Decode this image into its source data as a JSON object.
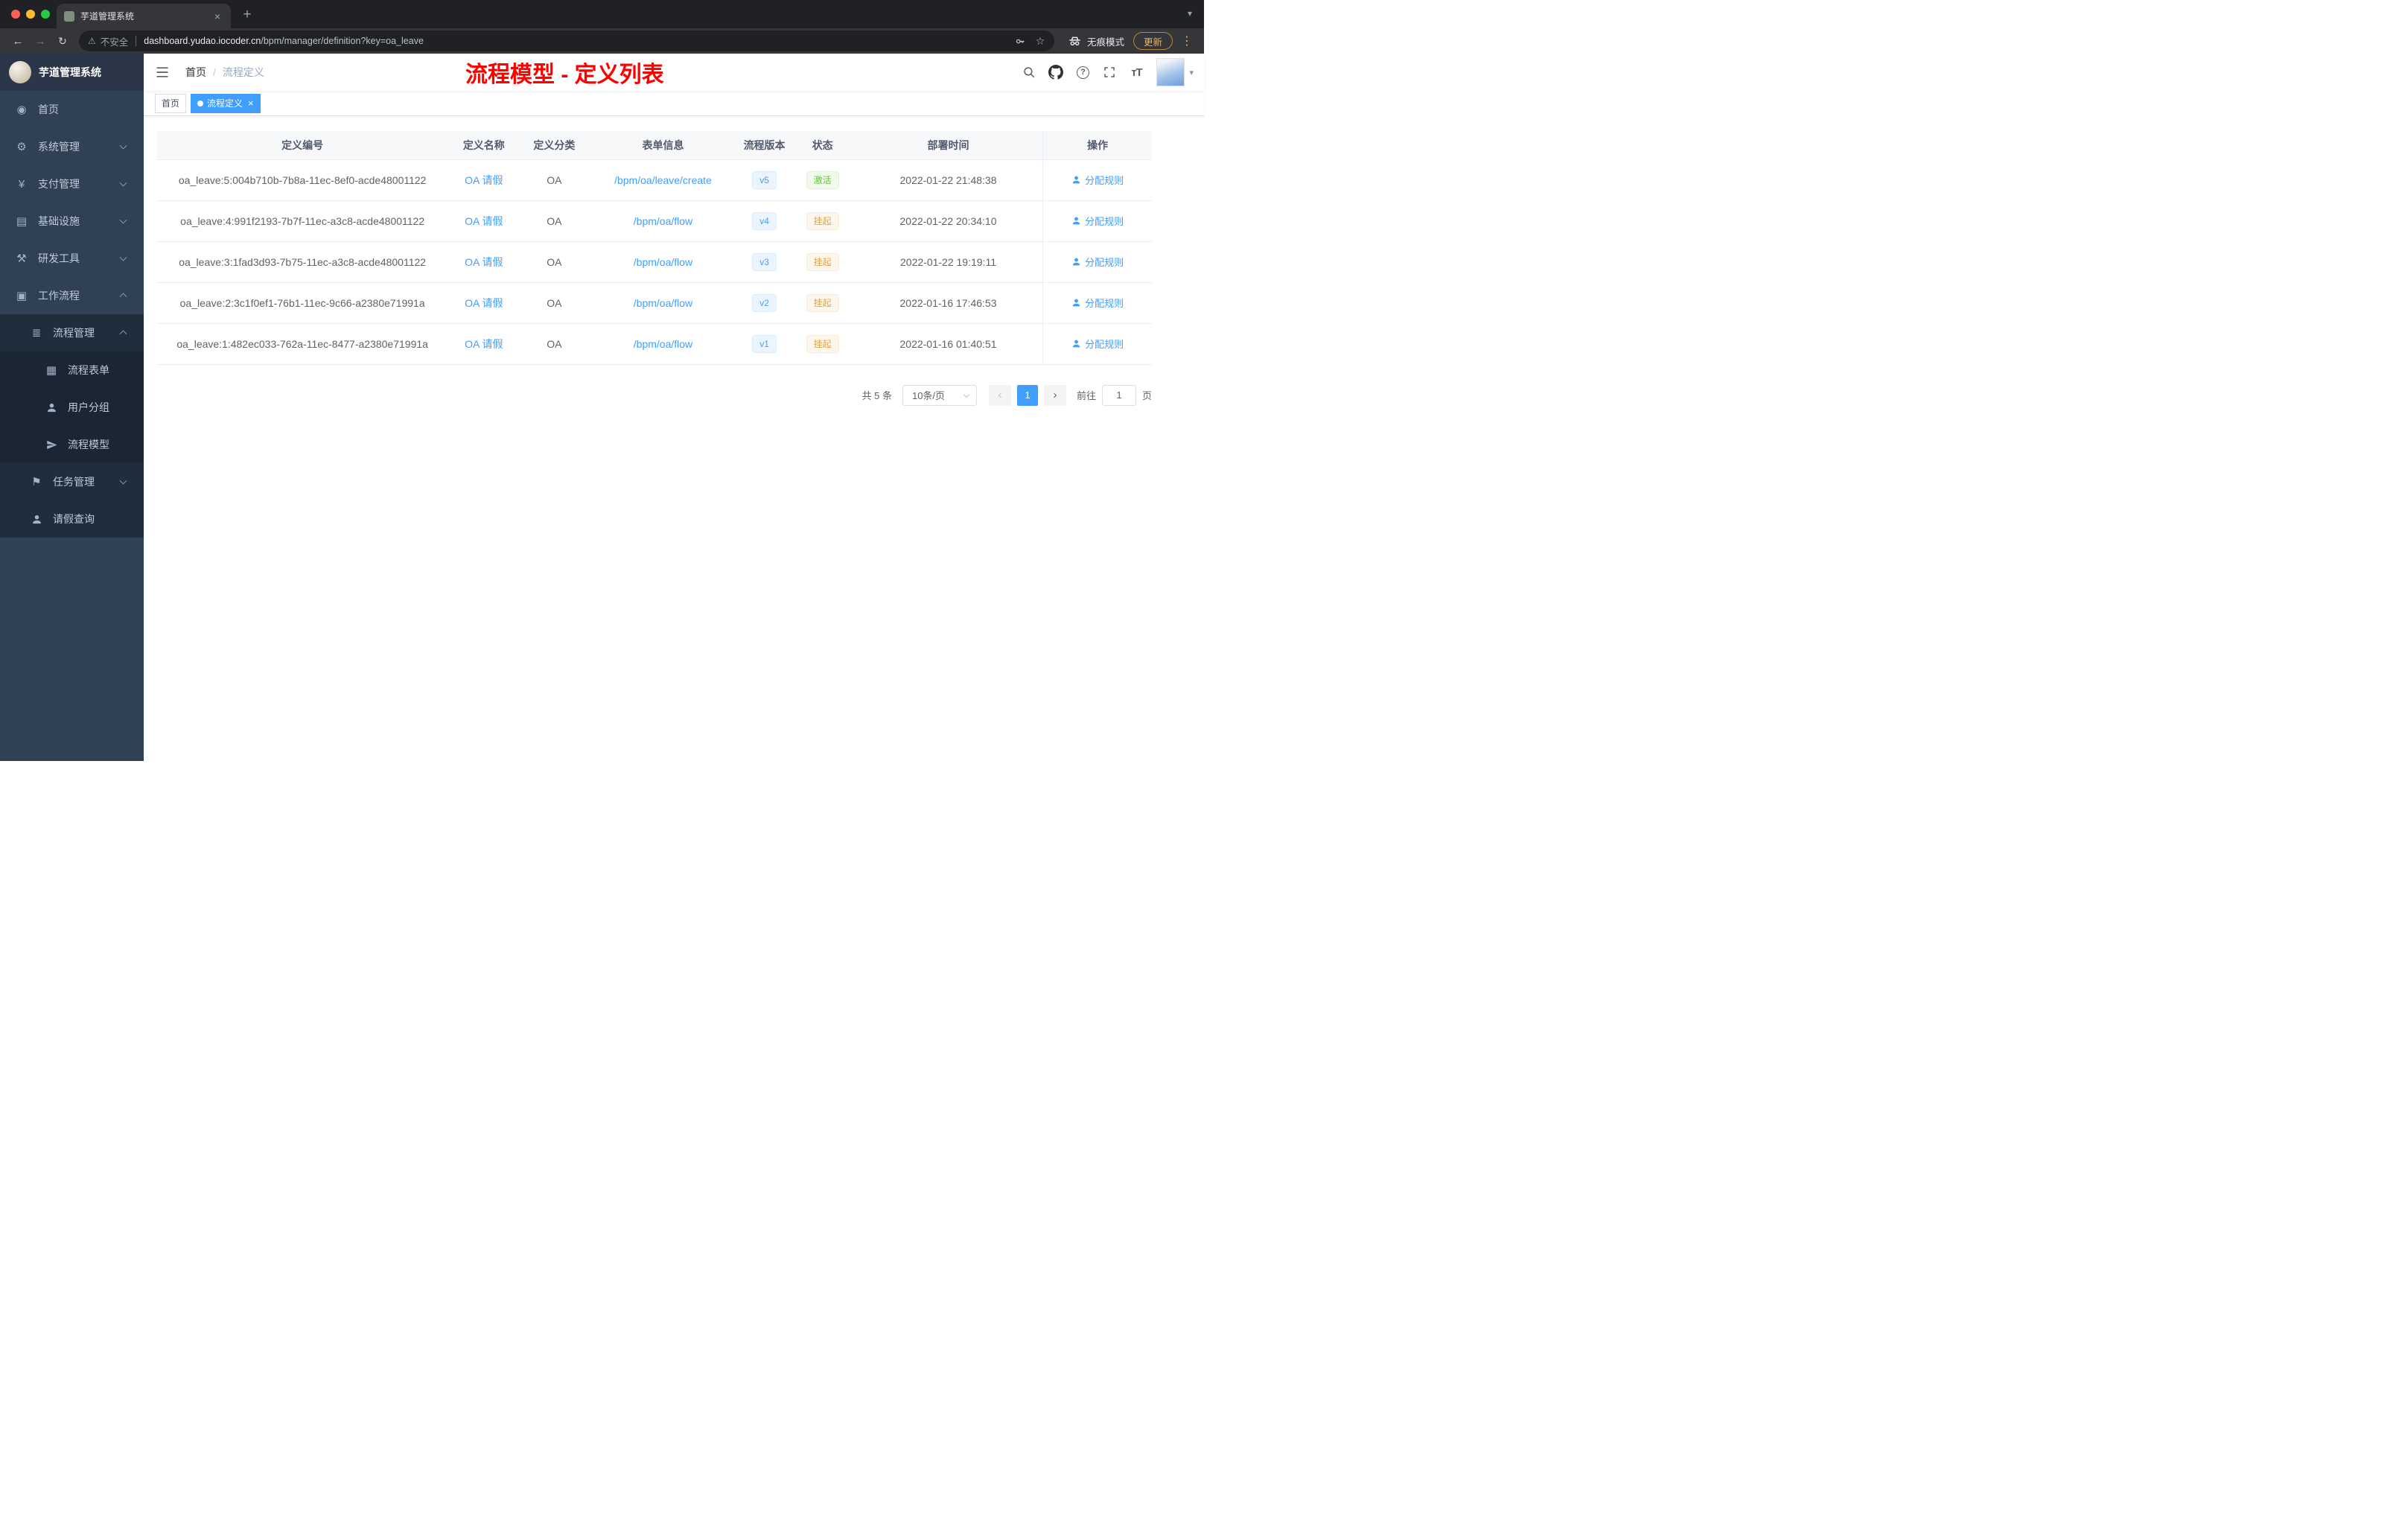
{
  "browser": {
    "tab": {
      "title": "芋道管理系统"
    },
    "url": {
      "security": "不安全",
      "domain": "dashboard.yudao.iocoder.cn",
      "path": "/bpm/manager/definition?key=oa_leave"
    },
    "incognito_label": "无痕模式",
    "update_label": "更新"
  },
  "icons": {
    "back": "←",
    "forward": "→",
    "reload": "↻",
    "star": "☆",
    "warning": "⚠",
    "menu_dots": "⋮",
    "new_tab": "+",
    "close": "×",
    "caret_down": "▾",
    "question": "?",
    "font_size": "тT",
    "prev": "‹",
    "next": "›"
  },
  "sidebar": {
    "logo_title": "芋道管理系统",
    "items": [
      {
        "label": "首页",
        "icon": "dashboard-icon",
        "glyph": "◉"
      },
      {
        "label": "系统管理",
        "icon": "gear-icon",
        "glyph": "⚙"
      },
      {
        "label": "支付管理",
        "icon": "payment-icon",
        "glyph": "¥"
      },
      {
        "label": "基础设施",
        "icon": "infra-icon",
        "glyph": "▤"
      },
      {
        "label": "研发工具",
        "icon": "tools-icon",
        "glyph": "⚒"
      },
      {
        "label": "工作流程",
        "icon": "workflow-icon",
        "glyph": "▣"
      },
      {
        "label": "流程管理",
        "icon": "process-list-icon",
        "glyph": "≣"
      },
      {
        "label": "流程表单",
        "icon": "form-icon",
        "glyph": "▦"
      },
      {
        "label": "用户分组",
        "icon": "users-icon"
      },
      {
        "label": "流程模型",
        "icon": "paper-plane-icon"
      },
      {
        "label": "任务管理",
        "icon": "task-icon",
        "glyph": "⚑"
      },
      {
        "label": "请假查询",
        "icon": "user-icon"
      }
    ]
  },
  "header": {
    "breadcrumb": [
      "首页",
      "流程定义"
    ],
    "breadcrumb_sep": "/",
    "annotation": "流程模型 - 定义列表"
  },
  "tags": [
    {
      "label": "首页"
    },
    {
      "label": "流程定义"
    }
  ],
  "table": {
    "columns": [
      "定义编号",
      "定义名称",
      "定义分类",
      "表单信息",
      "流程版本",
      "状态",
      "部署时间",
      "操作"
    ],
    "rows": [
      {
        "id": "oa_leave:5:004b710b-7b8a-11ec-8ef0-acde48001122",
        "name": "OA 请假",
        "category": "OA",
        "form": "/bpm/oa/leave/create",
        "version": "v5",
        "status": "激活",
        "status_type": "success",
        "deploy_time": "2022-01-22 21:48:38",
        "action": "分配规则"
      },
      {
        "id": "oa_leave:4:991f2193-7b7f-11ec-a3c8-acde48001122",
        "name": "OA 请假",
        "category": "OA",
        "form": "/bpm/oa/flow",
        "version": "v4",
        "status": "挂起",
        "status_type": "warning",
        "deploy_time": "2022-01-22 20:34:10",
        "action": "分配规则"
      },
      {
        "id": "oa_leave:3:1fad3d93-7b75-11ec-a3c8-acde48001122",
        "name": "OA 请假",
        "category": "OA",
        "form": "/bpm/oa/flow",
        "version": "v3",
        "status": "挂起",
        "status_type": "warning",
        "deploy_time": "2022-01-22 19:19:11",
        "action": "分配规则"
      },
      {
        "id": "oa_leave:2:3c1f0ef1-76b1-11ec-9c66-a2380e71991a",
        "name": "OA 请假",
        "category": "OA",
        "form": "/bpm/oa/flow",
        "version": "v2",
        "status": "挂起",
        "status_type": "warning",
        "deploy_time": "2022-01-16 17:46:53",
        "action": "分配规则"
      },
      {
        "id": "oa_leave:1:482ec033-762a-11ec-8477-a2380e71991a",
        "name": "OA 请假",
        "category": "OA",
        "form": "/bpm/oa/flow",
        "version": "v1",
        "status": "挂起",
        "status_type": "warning",
        "deploy_time": "2022-01-16 01:40:51",
        "action": "分配规则"
      }
    ]
  },
  "pagination": {
    "total": "共 5 条",
    "page_size": "10条/页",
    "current_page": "1",
    "goto_label": "前往",
    "goto_value": "1",
    "unit_label": "页"
  },
  "colors": {
    "accent": "#409eff",
    "annotation_red": "#fe0000",
    "success": "#67c23a",
    "warning": "#e6a23c"
  }
}
